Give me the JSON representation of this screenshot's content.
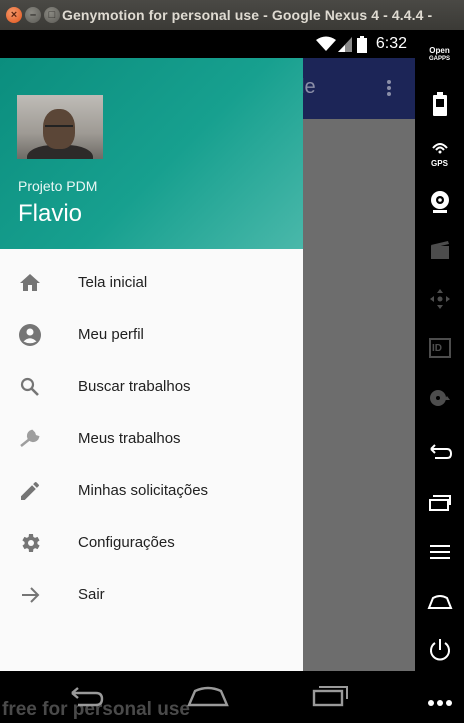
{
  "window": {
    "title": "Genymotion for personal use - Google Nexus 4 - 4.4.4 -",
    "close_glyph": "×",
    "min_glyph": "–",
    "max_glyph": "□"
  },
  "statusbar": {
    "time": "6:32"
  },
  "appbar": {
    "partial_title": "le"
  },
  "drawer": {
    "subtitle": "Projeto PDM",
    "name": "Flavio",
    "items": [
      {
        "label": "Tela inicial",
        "icon": "home-icon"
      },
      {
        "label": "Meu perfil",
        "icon": "account-circle-icon"
      },
      {
        "label": "Buscar trabalhos",
        "icon": "search-icon"
      },
      {
        "label": "Meus trabalhos",
        "icon": "wrench-icon"
      },
      {
        "label": "Minhas solicitações",
        "icon": "pencil-icon"
      },
      {
        "label": "Configurações",
        "icon": "gear-icon"
      },
      {
        "label": "Sair",
        "icon": "arrow-right-icon"
      }
    ]
  },
  "navbar": {
    "watermark": "free for personal use"
  },
  "sidebar": {
    "opengapps_line1": "Open",
    "opengapps_line2": "GAPPS",
    "gps_label": "GPS",
    "id_label": "ID"
  },
  "colors": {
    "header_teal": "#0b8e7e",
    "appbar_navy": "#1c2557",
    "scrim": "#6d6d6d",
    "drawer_bg": "#fafafa",
    "icon_gray": "#757575"
  }
}
